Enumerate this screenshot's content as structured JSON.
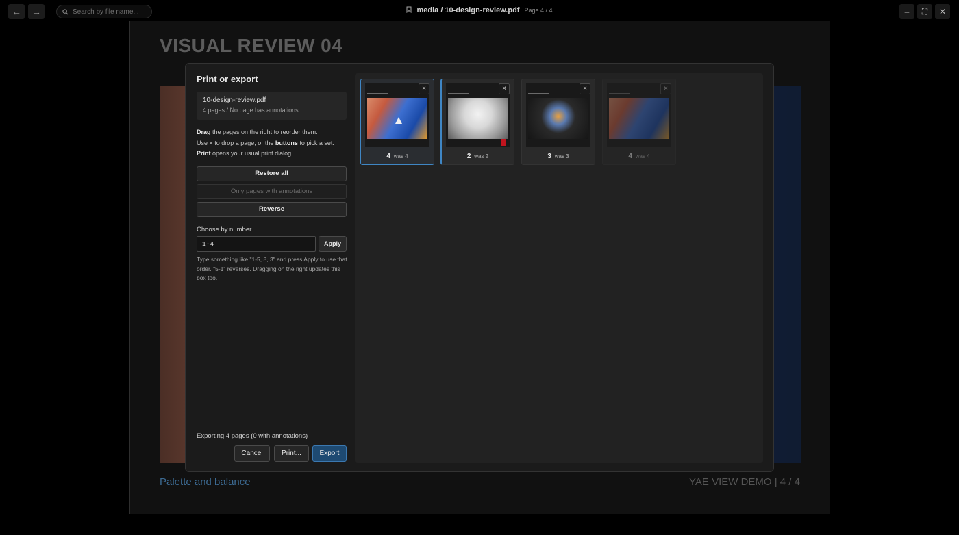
{
  "toolbar": {
    "back_icon": "←",
    "forward_icon": "→",
    "search_placeholder": "Search by file name..."
  },
  "titlebar": {
    "path": "media / 10-design-review.pdf",
    "page": "Page 4 / 4"
  },
  "window": {
    "minimize": "–",
    "maximize": "⛶",
    "close": "✕"
  },
  "slide": {
    "title": "VISUAL REVIEW 04",
    "caption": "Palette and balance",
    "footer": "YAE VIEW DEMO  |  4 / 4"
  },
  "dialog": {
    "title": "Print or export",
    "file": {
      "name": "10-design-review.pdf",
      "meta": "4 pages / No page has annotations"
    },
    "instructions": {
      "line1_bold": "Drag",
      "line1_rest": " the pages on the right to reorder them.",
      "line2_pre": "Use × to drop a page, or the ",
      "line2_bold": "buttons",
      "line2_rest": " to pick a set.",
      "line3_bold": "Print",
      "line3_rest": " opens your usual print dialog."
    },
    "buttons": {
      "restore_all": "Restore all",
      "only_annotated": "Only pages with annotations",
      "reverse": "Reverse"
    },
    "choose": {
      "label": "Choose by number",
      "value": "1-4",
      "apply": "Apply",
      "help": "Type something like \"1-5, 8, 3\" and press Apply to use that order. \"5-1\" reverses. Dragging on the right updates this box too."
    },
    "summary": "Exporting 4 pages (0 with annotations)",
    "footer": {
      "cancel": "Cancel",
      "print": "Print...",
      "export": "Export"
    },
    "thumbnails": [
      {
        "number": "4",
        "was": "was 4",
        "close": "×",
        "image": "fruit",
        "state": "selected"
      },
      {
        "number": "2",
        "was": "was 2",
        "close": "×",
        "image": "staircase",
        "state": "drop-target"
      },
      {
        "number": "3",
        "was": "was 3",
        "close": "×",
        "image": "sculpture",
        "state": "normal"
      },
      {
        "number": "4",
        "was": "was 4",
        "close": "×",
        "image": "fruit",
        "state": "removed"
      }
    ]
  },
  "colors": {
    "accent": "#3f86c4",
    "primary_button": "#1e4a72",
    "caption": "#3c6a92"
  }
}
